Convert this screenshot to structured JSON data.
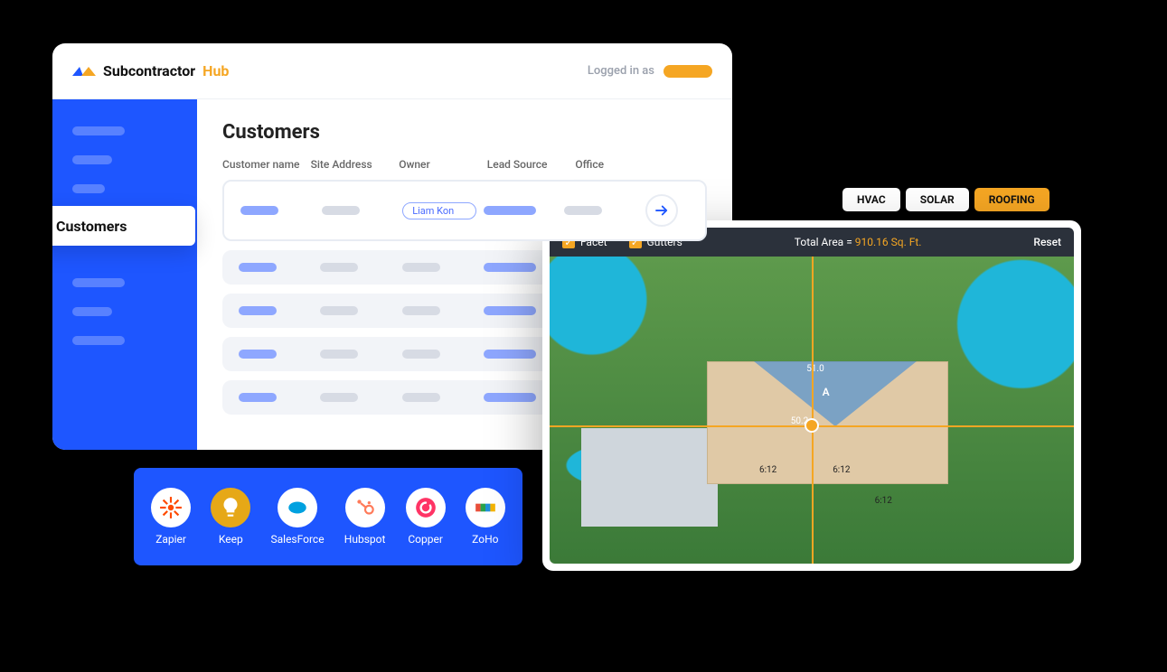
{
  "brand": {
    "name": "Subcontractor",
    "suffix": "Hub"
  },
  "header": {
    "logged_in_label": "Logged in as"
  },
  "sidebar": {
    "active_tab_label": "Customers"
  },
  "page": {
    "title": "Customers"
  },
  "table": {
    "columns": [
      "Customer name",
      "Site Address",
      "Owner",
      "Lead Source",
      "Office"
    ],
    "selected_owner_tag": "Liam Kon"
  },
  "integrations": [
    {
      "label": "Zapier"
    },
    {
      "label": "Keep"
    },
    {
      "label": "SalesForce"
    },
    {
      "label": "Hubspot"
    },
    {
      "label": "Copper"
    },
    {
      "label": "ZoHo"
    }
  ],
  "mode_tabs": [
    {
      "label": "HVAC",
      "active": false
    },
    {
      "label": "SOLAR",
      "active": false
    },
    {
      "label": "ROOFING",
      "active": true
    }
  ],
  "roof_tool": {
    "checkboxes": [
      {
        "label": "Facet",
        "checked": true
      },
      {
        "label": "Gutters",
        "checked": true
      }
    ],
    "total_label": "Total Area =",
    "total_value": "910.16 Sq. Ft.",
    "reset_label": "Reset",
    "facet_name": "A",
    "edge_length_top": "51.0",
    "edge_length_bottom": "50.2",
    "slope_labels": [
      "6:12",
      "6:12",
      "6:12"
    ]
  },
  "colors": {
    "brand_blue": "#1e56ff",
    "accent_amber": "#f5a623"
  }
}
